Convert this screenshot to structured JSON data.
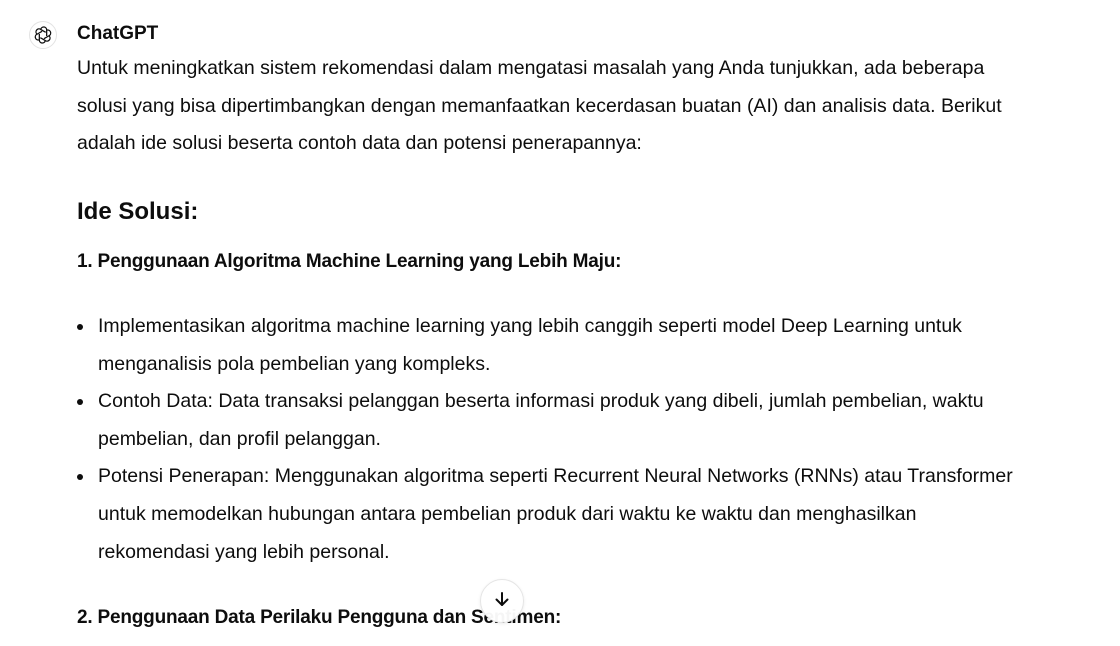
{
  "message": {
    "author": "ChatGPT",
    "avatar_icon": "openai-logo-icon",
    "intro": "Untuk meningkatkan sistem rekomendasi dalam mengatasi masalah yang Anda tunjukkan, ada beberapa solusi yang bisa dipertimbangkan dengan memanfaatkan kecerdasan buatan (AI) dan analisis data. Berikut adalah ide solusi beserta contoh data dan potensi penerapannya:",
    "heading": "Ide Solusi:",
    "section1": {
      "title": "1. Penggunaan Algoritma Machine Learning yang Lebih Maju:",
      "bullets": [
        "Implementasikan algoritma machine learning yang lebih canggih seperti model Deep Learning untuk menganalisis pola pembelian yang kompleks.",
        "Contoh Data: Data transaksi pelanggan beserta informasi produk yang dibeli, jumlah pembelian, waktu pembelian, dan profil pelanggan.",
        "Potensi Penerapan: Menggunakan algoritma seperti Recurrent Neural Networks (RNNs) atau Transformer untuk memodelkan hubungan antara pembelian produk dari waktu ke waktu dan menghasilkan rekomendasi yang lebih personal."
      ]
    },
    "section2": {
      "title": "2. Penggunaan Data Perilaku Pengguna dan Sentimen:"
    }
  },
  "controls": {
    "scroll_down_icon": "arrow-down-icon"
  }
}
